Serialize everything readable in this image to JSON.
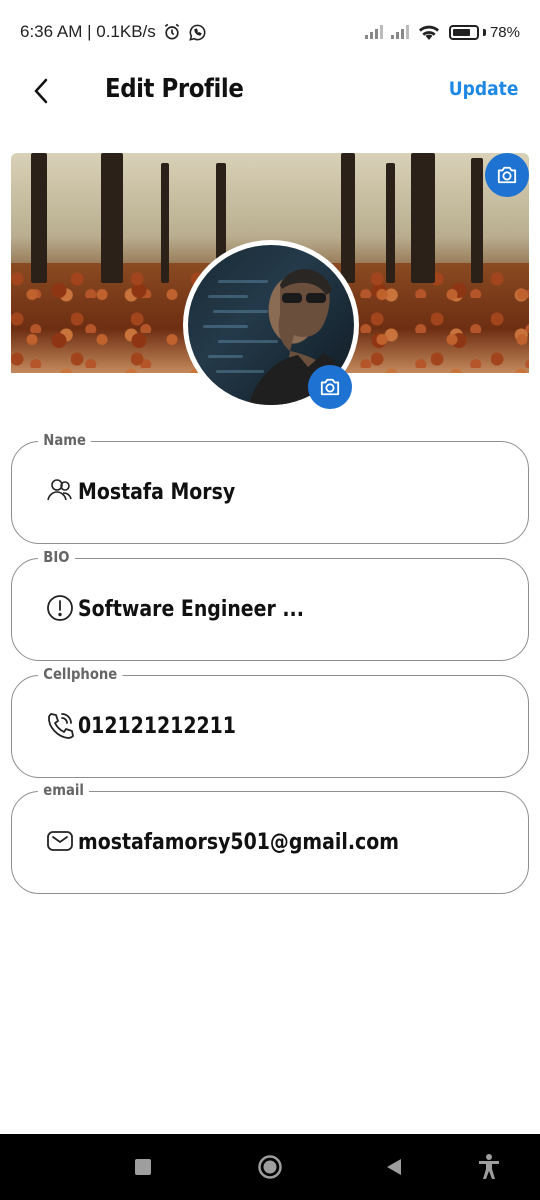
{
  "status_bar": {
    "time_speed": "6:36 AM | 0.1KB/s",
    "battery": "78%",
    "battery_level": 0.78
  },
  "header": {
    "title": "Edit Profile",
    "update_label": "Update"
  },
  "fields": [
    {
      "label": "Name",
      "value": "Mostafa Morsy",
      "icon": "person-icon"
    },
    {
      "label": "BIO",
      "value": "Software Engineer ...",
      "icon": "info-icon"
    },
    {
      "label": "Cellphone",
      "value": "012121212211",
      "icon": "phone-icon"
    },
    {
      "label": "email",
      "value": "mostafamorsy501@gmail.com",
      "icon": "mail-icon"
    }
  ],
  "colors": {
    "accent": "#1e88e5",
    "camera_button": "#1e73d2",
    "field_border": "#8f8f8f"
  }
}
